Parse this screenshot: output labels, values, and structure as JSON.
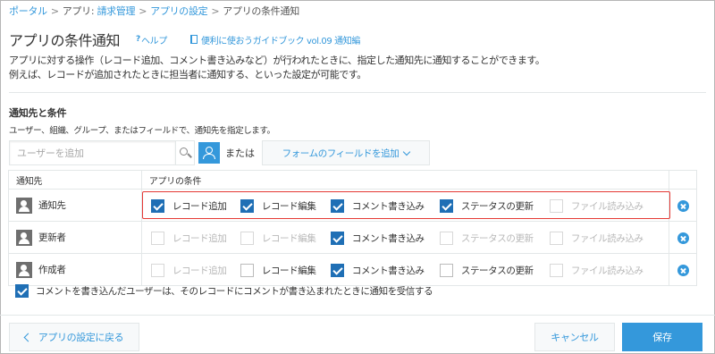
{
  "colors": {
    "accent": "#3498db",
    "checked": "#1f6fb5",
    "highlight": "#e53935"
  },
  "breadcrumb": [
    {
      "label": "ポータル",
      "link": true
    },
    {
      "label": "アプリ: ",
      "link": false
    },
    {
      "label": "請求管理",
      "link": true
    },
    {
      "label": "アプリの設定",
      "link": true
    },
    {
      "label": "アプリの条件通知",
      "link": false
    }
  ],
  "breadcrumb_sep": ">",
  "page": {
    "title": "アプリの条件通知",
    "help_icon": "?",
    "help_label": "ヘルプ",
    "guide_icon": "book-icon",
    "guide_label": "便利に使おうガイドブック vol.09 通知編",
    "desc_line1": "アプリに対する操作（レコード追加、コメント書き込みなど）が行われたときに、指定した通知先に通知することができます。",
    "desc_line2": "例えば、レコードが追加されたときに担当者に通知する、といった設定が可能です。"
  },
  "section": {
    "title": "通知先と条件",
    "desc": "ユーザー、組織、グループ、またはフィールドで、通知先を指定します。",
    "user_input_placeholder": "ユーザーを追加",
    "search_icon": "search-icon",
    "org_icon": "organization-select-icon",
    "or_text": "または",
    "field_add_label": "フォームのフィールドを追加"
  },
  "table": {
    "headers": [
      "通知先",
      "アプリの条件",
      ""
    ],
    "rows": [
      {
        "target": "通知先",
        "conditions": [
          {
            "label": "レコード追加",
            "checked": true,
            "enabled": true
          },
          {
            "label": "レコード編集",
            "checked": true,
            "enabled": true
          },
          {
            "label": "コメント書き込み",
            "checked": true,
            "enabled": true
          },
          {
            "label": "ステータスの更新",
            "checked": true,
            "enabled": true
          },
          {
            "label": "ファイル読み込み",
            "checked": false,
            "enabled": false
          }
        ]
      },
      {
        "target": "更新者",
        "conditions": [
          {
            "label": "レコード追加",
            "checked": false,
            "enabled": false
          },
          {
            "label": "レコード編集",
            "checked": false,
            "enabled": false
          },
          {
            "label": "コメント書き込み",
            "checked": true,
            "enabled": true
          },
          {
            "label": "ステータスの更新",
            "checked": false,
            "enabled": false
          },
          {
            "label": "ファイル読み込み",
            "checked": false,
            "enabled": false
          }
        ]
      },
      {
        "target": "作成者",
        "conditions": [
          {
            "label": "レコード追加",
            "checked": false,
            "enabled": false
          },
          {
            "label": "レコード編集",
            "checked": false,
            "enabled": true
          },
          {
            "label": "コメント書き込み",
            "checked": true,
            "enabled": true
          },
          {
            "label": "ステータスの更新",
            "checked": false,
            "enabled": true
          },
          {
            "label": "ファイル読み込み",
            "checked": false,
            "enabled": false
          }
        ]
      }
    ]
  },
  "comment_notify": {
    "label": "コメントを書き込んだユーザーは、そのレコードにコメントが書き込まれたときに通知を受信する",
    "checked": true
  },
  "footer": {
    "back_label": "アプリの設定に戻る",
    "cancel_label": "キャンセル",
    "save_label": "保存"
  }
}
